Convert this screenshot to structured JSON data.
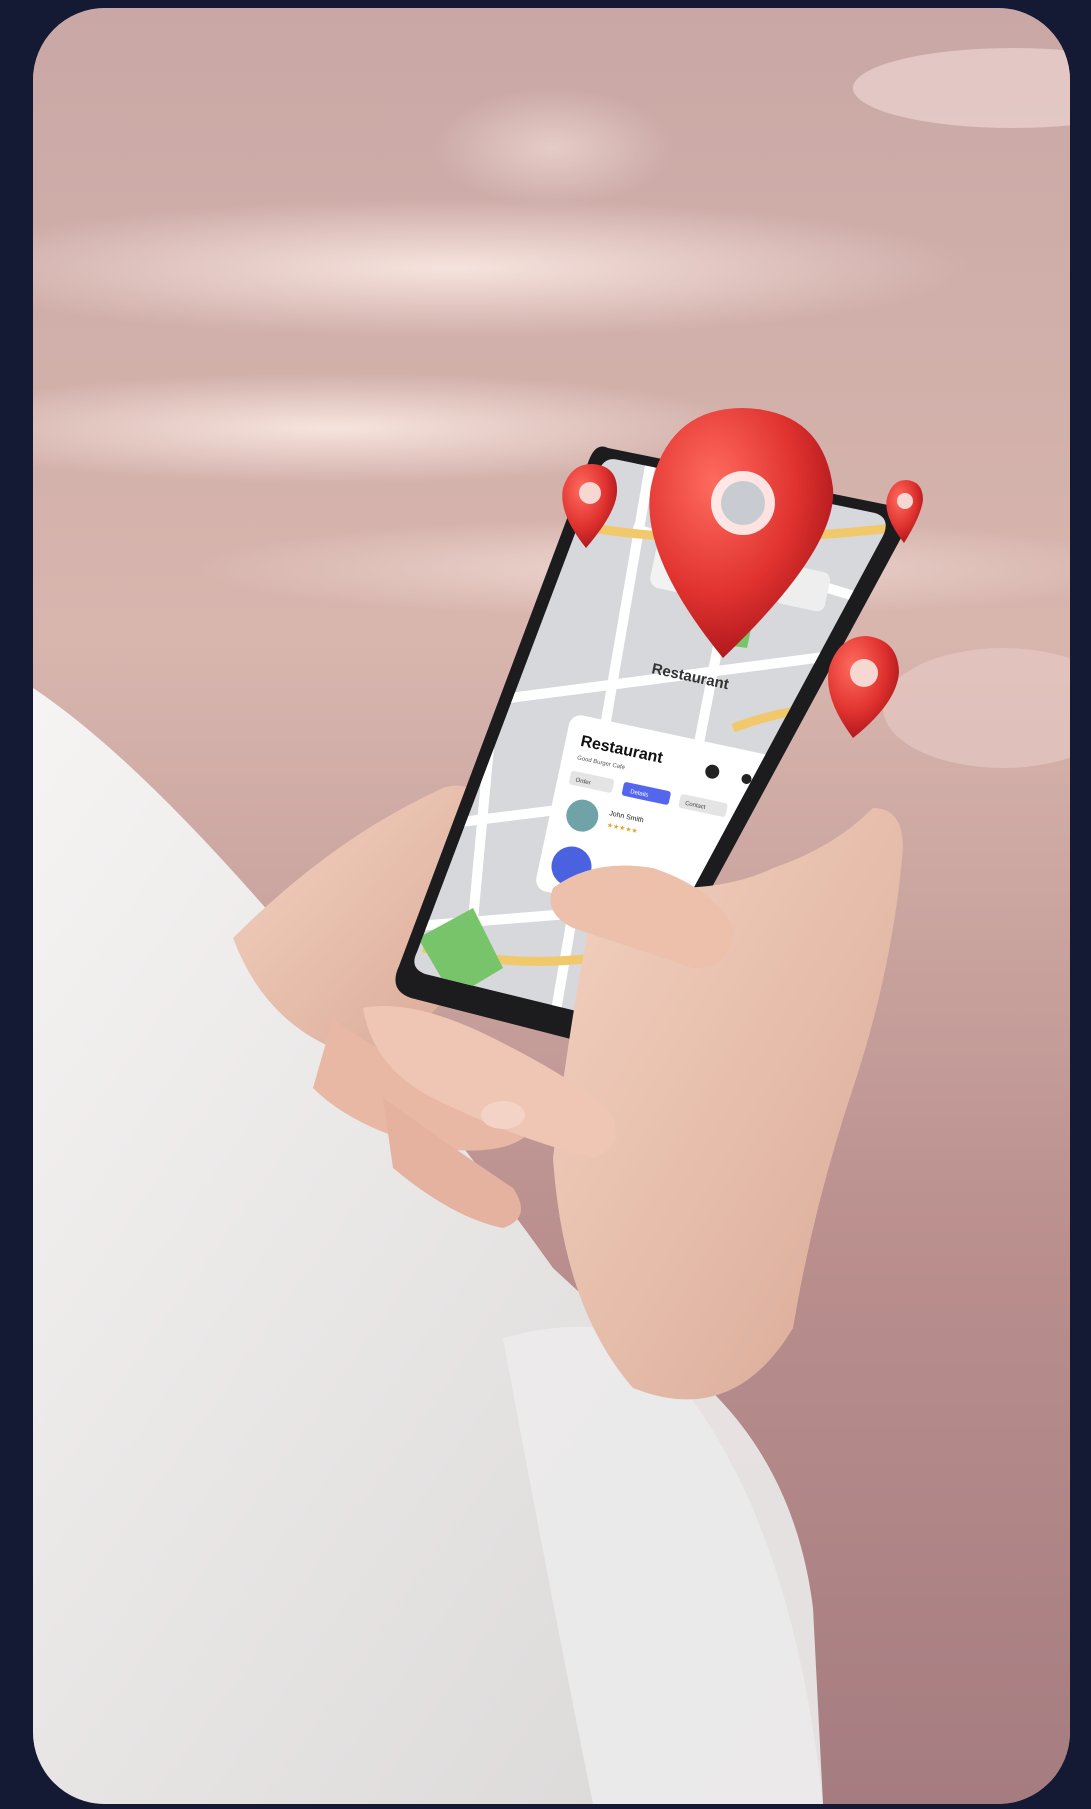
{
  "photo": {
    "map_label": "Restaurant",
    "panel": {
      "title": "Restaurant",
      "subtitle": "Good Burger Café",
      "icons": [
        "car-icon",
        "walk-icon"
      ],
      "tabs": [
        "Order",
        "Details",
        "Contact"
      ],
      "reviewer_name": "John Smith",
      "stars": "★★★★★"
    }
  },
  "colors": {
    "frame": "#141a33",
    "pin_red": "#e0322f",
    "tab_active": "#5566ee",
    "map_grey": "#d6d8dc",
    "map_road": "#f1c86a",
    "park_green": "#78c46a"
  }
}
